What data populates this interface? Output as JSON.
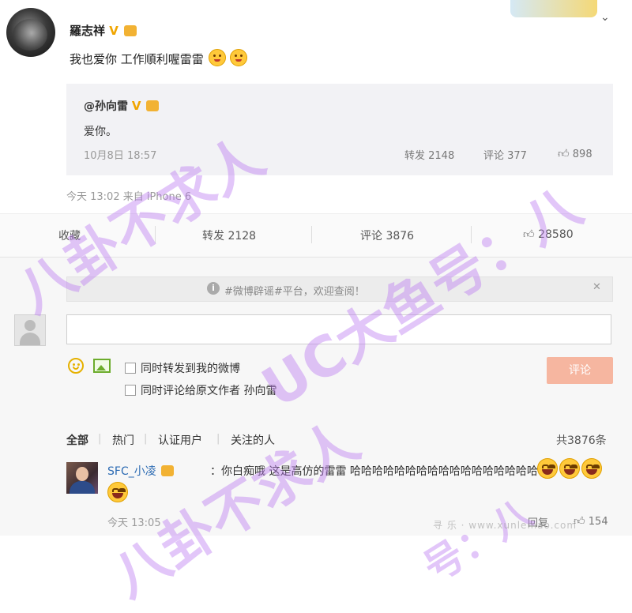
{
  "post": {
    "author": "羅志祥",
    "verified_badge": "V",
    "text": "我也爱你 工作順利喔雷雷",
    "meta": "今天 13:02 来自 iPhone 6"
  },
  "quote": {
    "author": "@孙向雷",
    "text": "爱你。",
    "date": "10月8日 18:57",
    "repost": "转发 2148",
    "comment": "评论 377",
    "like": "898"
  },
  "actions": {
    "favorite": "收藏",
    "repost": "转发 2128",
    "comment": "评论 3876",
    "like": "28580"
  },
  "notice": {
    "icon": "i",
    "text": "#微博辟谣#平台，欢迎查阅！",
    "close": "✕"
  },
  "composer": {
    "placeholder": "",
    "check_repost_label": "同时转发到我的微博",
    "check_comment_author_label": "同时评论给原文作者 孙向雷",
    "submit_label": "评论"
  },
  "filters": {
    "all": "全部",
    "hot": "热门",
    "verified": "认证用户",
    "following": "关注的人",
    "count": "共3876条"
  },
  "comments": [
    {
      "user": "SFC_小凌",
      "text": "：你白痴哦 这是高仿的雷雷 哈哈哈哈哈哈哈哈哈哈哈哈哈哈哈哈哈哈",
      "time": "今天 13:05",
      "reply": "回复",
      "likes": "154"
    }
  ],
  "watermark": {
    "line1": "八卦不求人",
    "line2": "UC大鱼号：八",
    "line3": "八卦不求人",
    "line4": "号：八"
  },
  "site_mark": "寻 乐 · www.xunlemao.com",
  "icons": {
    "thumb": "thumb-up-icon",
    "chevron": "chevron-down-icon",
    "emoji": "smiley-icon",
    "image": "image-icon",
    "info": "info-icon"
  },
  "colors": {
    "link": "#2c6bb3",
    "submit": "#f6b6a0",
    "watermark": "#ba78f0",
    "verified": "#f0a500"
  }
}
